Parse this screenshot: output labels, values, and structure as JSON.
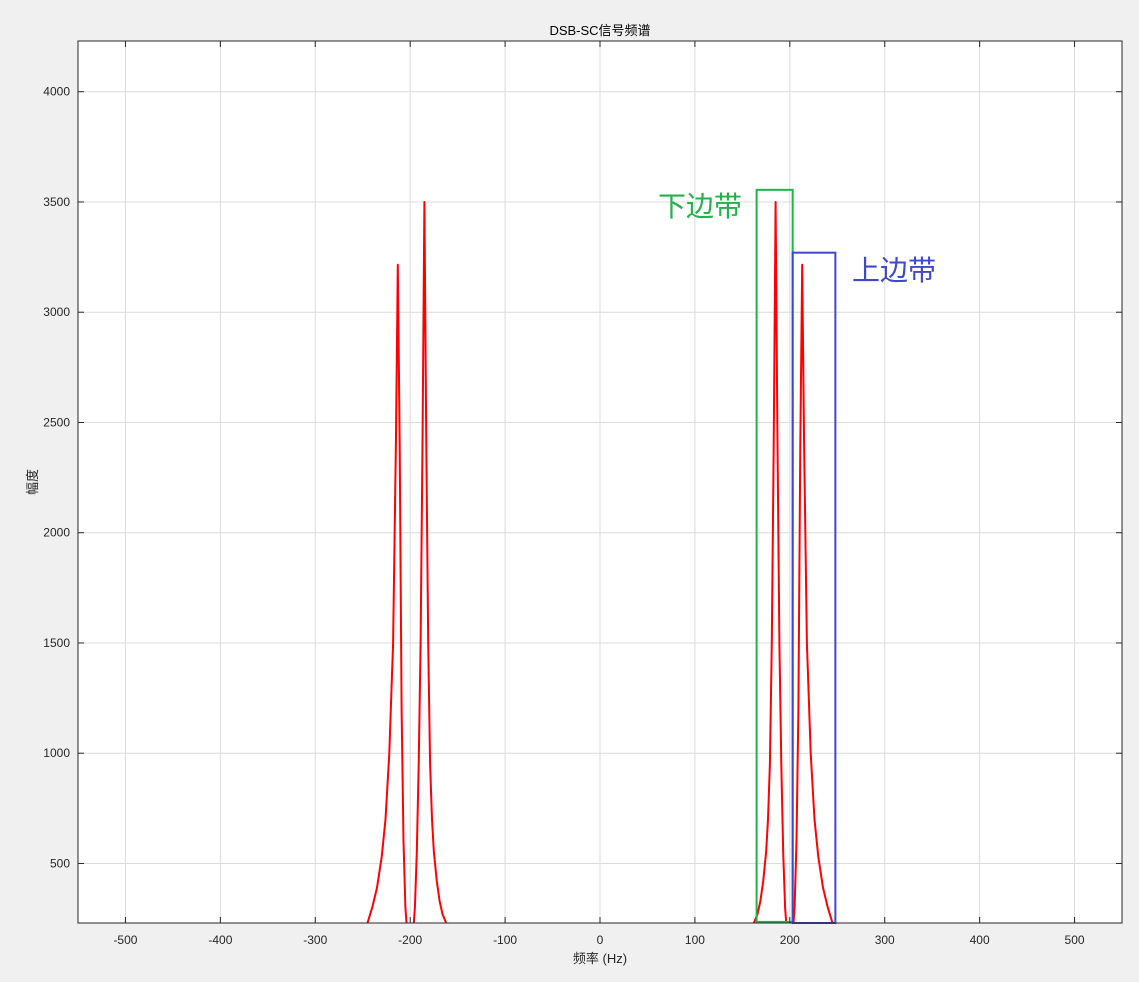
{
  "chart_data": {
    "type": "line",
    "title": "DSB-SC信号频谱",
    "xlabel": "频率 (Hz)",
    "ylabel": "幅度",
    "xlim": [
      -550,
      550
    ],
    "ylim": [
      230,
      4230
    ],
    "grid": true,
    "xticks": [
      -500,
      -400,
      -300,
      -200,
      -100,
      0,
      100,
      200,
      300,
      400,
      500
    ],
    "yticks": [
      500,
      1000,
      1500,
      2000,
      2500,
      3000,
      3500,
      4000
    ],
    "series": [
      {
        "color": "#ff0000",
        "x": [
          -245,
          -240,
          -235,
          -230,
          -226,
          -222,
          -218,
          -215,
          -213,
          -211,
          -209,
          -207,
          -205,
          -203,
          -200,
          -197,
          -195,
          -193,
          -191,
          -189,
          -187,
          -185,
          -183,
          -181,
          -179,
          -177,
          -175,
          -172,
          -169,
          -166,
          -162,
          -158,
          -155
        ],
        "y": [
          230,
          300,
          390,
          530,
          700,
          1000,
          1500,
          2400,
          3215,
          2400,
          1200,
          600,
          300,
          180,
          150,
          180,
          300,
          550,
          950,
          1500,
          2400,
          3500,
          2400,
          1500,
          950,
          700,
          550,
          420,
          330,
          270,
          230,
          210,
          200
        ]
      },
      {
        "color": "#ff0000",
        "x": [
          155,
          158,
          162,
          166,
          169,
          172,
          175,
          177,
          179,
          181,
          183,
          185,
          187,
          189,
          191,
          193,
          195,
          197,
          200,
          203,
          205,
          207,
          209,
          211,
          213,
          215,
          218,
          222,
          226,
          230,
          235,
          240,
          245
        ],
        "y": [
          200,
          210,
          230,
          270,
          330,
          420,
          550,
          700,
          950,
          1500,
          2400,
          3500,
          2400,
          1500,
          950,
          550,
          300,
          180,
          150,
          180,
          300,
          600,
          1200,
          2400,
          3215,
          2400,
          1500,
          1000,
          700,
          530,
          390,
          300,
          230
        ]
      }
    ],
    "annotations": [
      {
        "text": "下边带",
        "color": "#22b14c",
        "box_x": [
          165,
          203
        ],
        "box_y": [
          235,
          3555
        ]
      },
      {
        "text": "上边带",
        "color": "#3f48cc",
        "box_x": [
          203,
          248
        ],
        "box_y": [
          225,
          3270
        ]
      }
    ]
  }
}
